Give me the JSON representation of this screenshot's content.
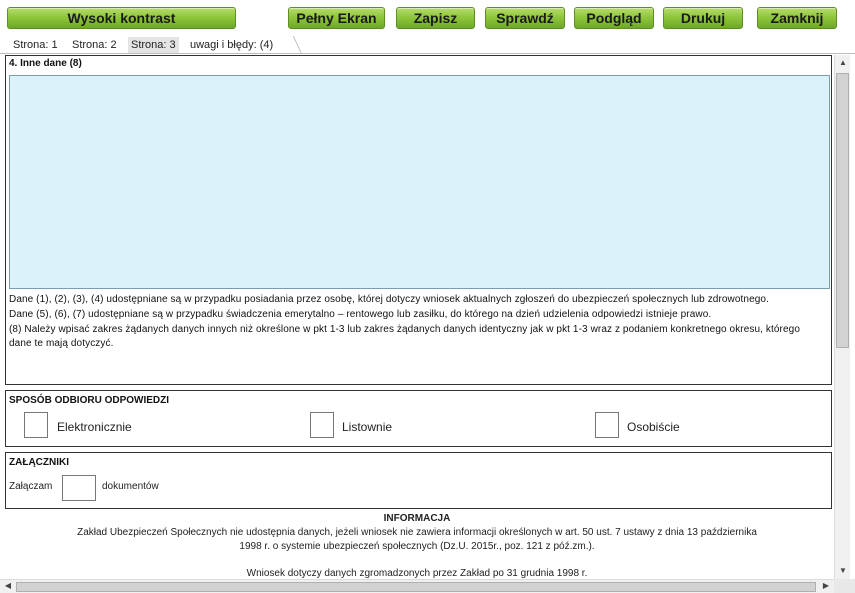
{
  "toolbar": {
    "high_contrast": "Wysoki kontrast",
    "full_screen": "Pełny Ekran",
    "save": "Zapisz",
    "check": "Sprawdź",
    "preview": "Podgląd",
    "print": "Drukuj",
    "close": "Zamknij",
    "button_color": "#8cc43a"
  },
  "tabs": [
    {
      "label": "Strona: 1",
      "active": false
    },
    {
      "label": "Strona: 2",
      "active": false
    },
    {
      "label": "Strona: 3",
      "active": true
    },
    {
      "label": "uwagi i błędy: (4)",
      "active": false
    }
  ],
  "other_data": {
    "title": "4. Inne dane (8)",
    "textarea_value": "",
    "notes": [
      "Dane (1), (2), (3), (4) udostępniane są w przypadku posiadania przez osobę, której dotyczy wniosek aktualnych zgłoszeń do ubezpieczeń społecznych lub zdrowotnego.",
      "Dane (5), (6), (7) udostępniane są w przypadku świadczenia emerytalno – rentowego lub zasiłku, do którego na dzień udzielenia odpowiedzi istnieje prawo.",
      "(8) Należy wpisać zakres żądanych danych innych niż określone w pkt 1-3 lub zakres żądanych danych identyczny jak w pkt 1-3 wraz z podaniem konkretnego okresu, którego dane te mają dotyczyć."
    ]
  },
  "response_method": {
    "title": "SPOSÓB ODBIORU ODPOWIEDZI",
    "options": [
      "Elektronicznie",
      "Listownie",
      "Osobiście"
    ]
  },
  "attachments": {
    "title": "ZAŁĄCZNIKI",
    "prefix": "Załączam",
    "value": "",
    "suffix": "dokumentów"
  },
  "info": {
    "title": "INFORMACJA",
    "line1": "Zakład Ubezpieczeń Społecznych nie udostępnia danych, jeżeli wniosek nie zawiera informacji określonych w art. 50 ust. 7 ustawy z dnia 13 października",
    "line2": "1998 r. o systemie ubezpieczeń społecznych (Dz.U. 2015r., poz. 121 z póź.zm.).",
    "line3": "Wniosek dotyczy danych zgromadzonych przez Zakład po 31 grudnia 1998 r."
  },
  "colors": {
    "textarea_bg": "#dcf2fa",
    "active_tab": "#e4e4e4"
  }
}
